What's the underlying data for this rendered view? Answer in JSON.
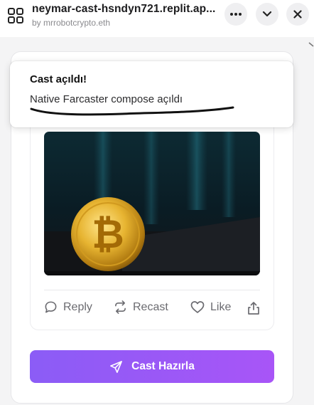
{
  "window": {
    "title": "neymar-cast-hsndyn721.replit.ap...",
    "subtitle": "by mrrobotcrypto.eth",
    "buttons": {
      "more": "more-horizontal-icon",
      "collapse": "chevron-down-icon",
      "close": "close-icon"
    }
  },
  "toast": {
    "title": "Cast açıldı!",
    "description": "Native Farcaster compose açıldı"
  },
  "cast": {
    "image_alt": "bitcoin coin photo",
    "actions": [
      {
        "label": "Reply",
        "icon": "comment-icon"
      },
      {
        "label": "Recast",
        "icon": "recast-icon"
      },
      {
        "label": "Like",
        "icon": "heart-icon"
      },
      {
        "label": "",
        "icon": "share-icon"
      }
    ]
  },
  "cta": {
    "label": "Cast Hazırla",
    "icon": "send-icon"
  },
  "colors": {
    "accent_start": "#8b5cf6",
    "accent_end": "#a855f7",
    "muted_text": "#6b6b70"
  }
}
